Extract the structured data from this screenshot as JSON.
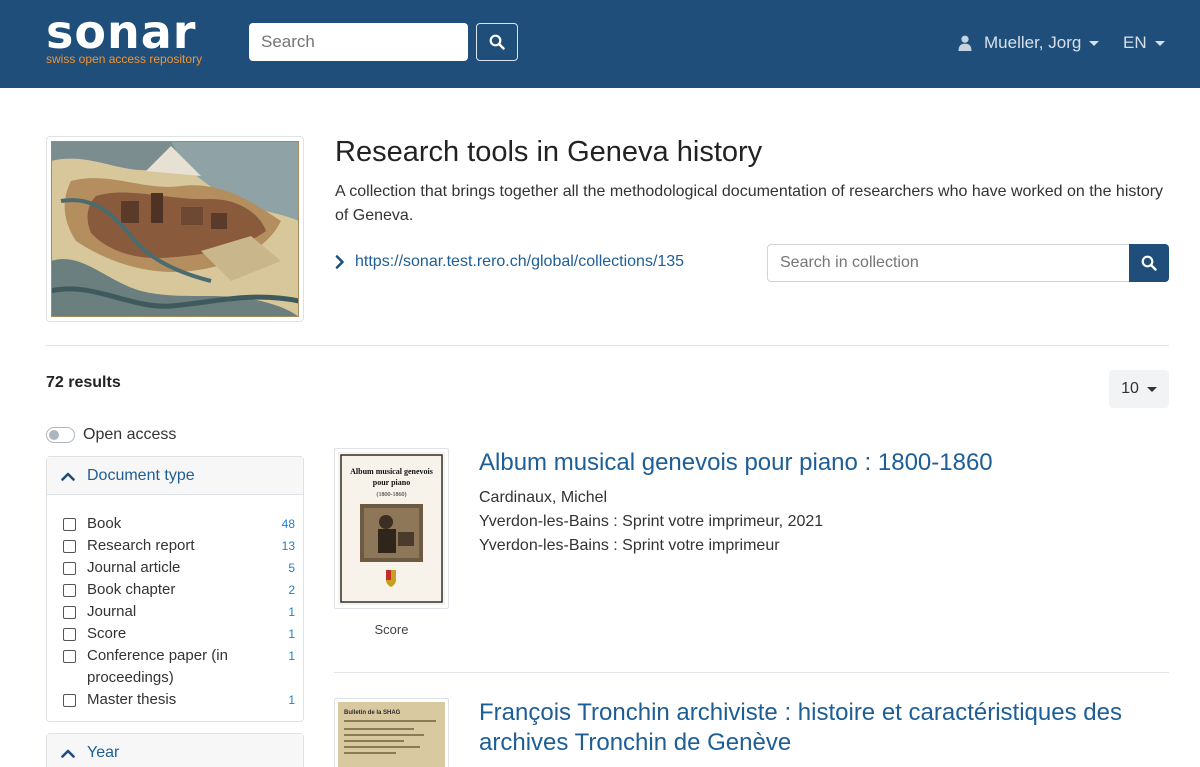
{
  "navbar": {
    "logo_text": "sonar",
    "logo_tagline": "swiss open access repository",
    "search_placeholder": "Search",
    "user_name": "Mueller, Jorg",
    "language": "EN"
  },
  "collection": {
    "title": "Research tools in Geneva history",
    "description": "A collection that brings together all the methodological documentation of researchers who have worked on the history of Geneva.",
    "link": "https://sonar.test.rero.ch/global/collections/135",
    "search_placeholder": "Search in collection"
  },
  "results": {
    "count_label": "72 results",
    "page_size": "10"
  },
  "facets": {
    "open_access_label": "Open access",
    "document_type": {
      "title": "Document type",
      "items": [
        {
          "label": "Book",
          "count": "48"
        },
        {
          "label": "Research report",
          "count": "13"
        },
        {
          "label": "Journal article",
          "count": "5"
        },
        {
          "label": "Book chapter",
          "count": "2"
        },
        {
          "label": "Journal",
          "count": "1"
        },
        {
          "label": "Score",
          "count": "1"
        },
        {
          "label": "Conference paper (in proceedings)",
          "count": "1"
        },
        {
          "label": "Master thesis",
          "count": "1"
        }
      ]
    },
    "year": {
      "title": "Year"
    }
  },
  "records": [
    {
      "title": "Album musical genevois pour piano : 1800-1860",
      "lines": [
        "Cardinaux, Michel",
        "Yverdon-les-Bains : Sprint votre imprimeur, 2021",
        "Yverdon-les-Bains : Sprint votre imprimeur"
      ],
      "type": "Score",
      "cover_title_1": "Album musical genevois",
      "cover_title_2": "pour piano",
      "cover_title_3": "(1800-1860)"
    },
    {
      "title": "François Tronchin archiviste : histoire et caractéristiques des archives Tronchin de Genève",
      "cover_title_1": "Bulletin de la SHAG"
    }
  ],
  "colors": {
    "navbar": "#1e4e79",
    "accent_orange": "#f29431",
    "link_blue": "#1e5e96",
    "count_blue": "#1e7fc9"
  }
}
